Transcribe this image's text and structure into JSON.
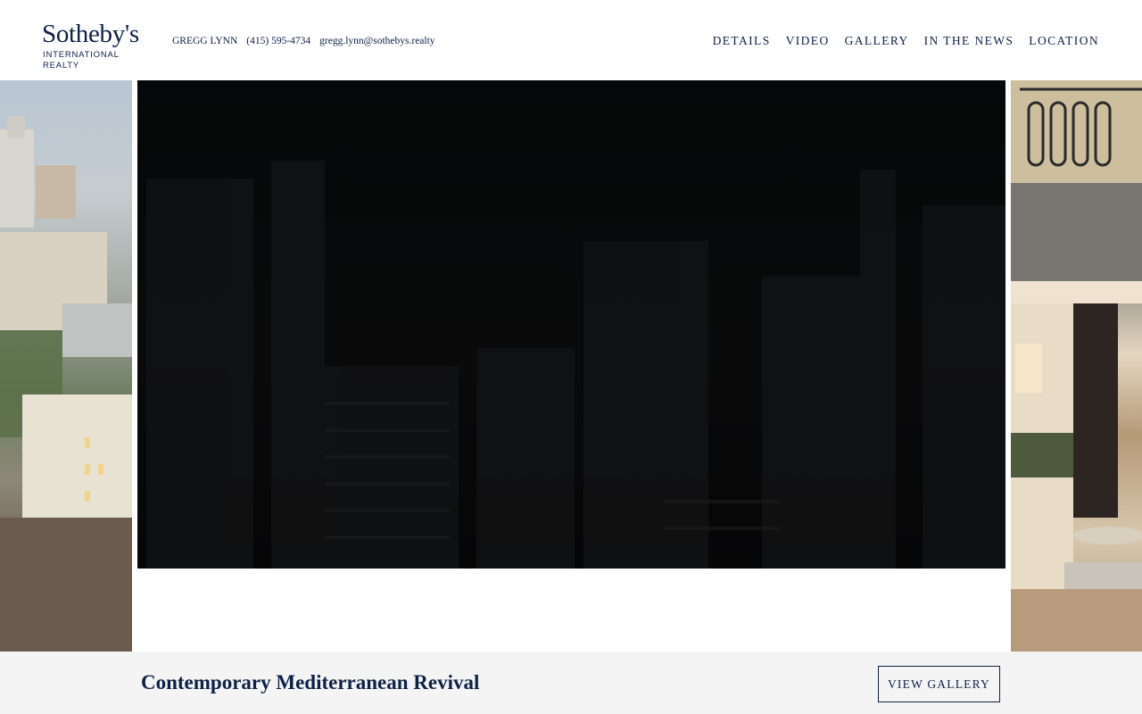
{
  "brand": {
    "logo_word": "Sotheby's",
    "logo_sub": "INTERNATIONAL REALTY",
    "color": "#0d2147"
  },
  "agent": {
    "name": "GREGG LYNN",
    "phone": "(415) 595-4734",
    "email": "gregg.lynn@sothebys.realty"
  },
  "nav": {
    "items": [
      "DETAILS",
      "VIDEO",
      "GALLERY",
      "IN THE NEWS",
      "LOCATION"
    ]
  },
  "hero": {
    "video_state": "dark-loading"
  },
  "listing": {
    "title": "Contemporary Mediterranean Revival",
    "view_gallery_label": "VIEW GALLERY"
  }
}
